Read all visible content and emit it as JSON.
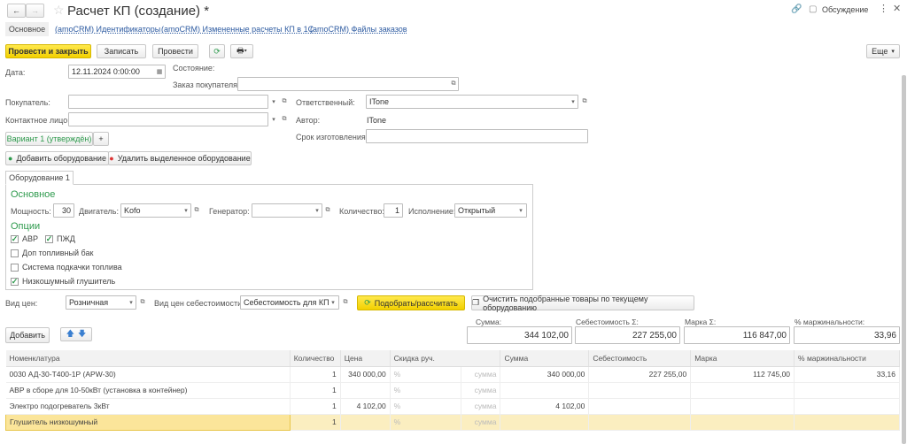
{
  "header": {
    "title": "Расчет КП (создание) *",
    "discussion": "Обсуждение"
  },
  "tabs": [
    {
      "label": "Основное"
    },
    {
      "label": "(amoCRM) Идентификаторы"
    },
    {
      "label": "(amoCRM) Измененные расчеты КП в 1С"
    },
    {
      "label": "(amoCRM) Файлы заказов"
    }
  ],
  "toolbar": {
    "post_close": "Провести и закрыть",
    "save": "Записать",
    "post": "Провести",
    "more": "Еще"
  },
  "form": {
    "date_label": "Дата:",
    "date_value": "12.11.2024  0:00:00",
    "state_label": "Состояние:",
    "order_label": "Заказ покупателя:",
    "order_value": "",
    "buyer_label": "Покупатель:",
    "buyer_value": "",
    "contact_label": "Контактное лицо:",
    "contact_value": "",
    "responsible_label": "Ответственный:",
    "responsible_value": "ITone",
    "author_label": "Автор:",
    "author_value": "ITone",
    "deadline_label": "Срок изготовления:",
    "deadline_value": "",
    "variant": "Вариант 1 (утверждён)",
    "variant_add": "+",
    "add_equipment": "Добавить оборудование",
    "remove_equipment": "Удалить выделенное оборудование"
  },
  "equipment": {
    "tab": "Оборудование 1",
    "section_main": "Основное",
    "power_label": "Мощность:",
    "power_value": "30",
    "engine_label": "Двигатель:",
    "engine_value": "Kofo",
    "generator_label": "Генератор:",
    "generator_value": "",
    "qty_label": "Количество:",
    "qty_value": "1",
    "execution_label": "Исполнение:",
    "execution_value": "Открытый",
    "section_options": "Опции",
    "options": [
      {
        "label": "АВР",
        "checked": true
      },
      {
        "label": "ПЖД",
        "checked": true
      },
      {
        "label": "Доп топливный бак",
        "checked": false
      },
      {
        "label": "Система подкачки топлива",
        "checked": false
      },
      {
        "label": "Низкошумный глушитель",
        "checked": true
      }
    ]
  },
  "pricing": {
    "price_type_label": "Вид цен:",
    "price_type_value": "Розничная",
    "cost_type_label": "Вид цен себестоимости:",
    "cost_type_value": "Себестоимость для КП",
    "calc": "Подобрать/рассчитать",
    "clear": "Очистить подобранные товары по текущему оборудованию"
  },
  "totals": [
    {
      "label": "Сумма:",
      "value": "344 102,00"
    },
    {
      "label": "Себестоимость Σ:",
      "value": "227 255,00"
    },
    {
      "label": "Марка Σ:",
      "value": "116 847,00"
    },
    {
      "label": "% маржинальности:",
      "value": "33,96"
    }
  ],
  "table": {
    "add": "Добавить",
    "columns": [
      "Номенклатура",
      "Количество",
      "Цена",
      "Скидка руч.",
      "Сумма",
      "Себестоимость",
      "Марка",
      "% маржинальности"
    ],
    "rows": [
      [
        "0030 АД-30-Т400-1Р (APW-30)",
        "1",
        "340 000,00",
        "%",
        "сумма",
        "340 000,00",
        "227 255,00",
        "112 745,00",
        "33,16"
      ],
      [
        "АВР в сборе для 10-50кВт (установка в контейнер)",
        "1",
        "",
        "%",
        "сумма",
        "",
        "",
        "",
        ""
      ],
      [
        "Электро подогреватель 3кВт",
        "1",
        "4 102,00",
        "%",
        "сумма",
        "4 102,00",
        "",
        "",
        ""
      ],
      [
        "Глушитель низкошумный",
        "1",
        "",
        "%",
        "сумма",
        "",
        "",
        "",
        ""
      ]
    ]
  },
  "colors": {
    "accent_yellow": "#f2d000",
    "section_green": "#2e9a4d",
    "link_blue": "#2c5aa0",
    "selected_row": "#fbeec0"
  }
}
